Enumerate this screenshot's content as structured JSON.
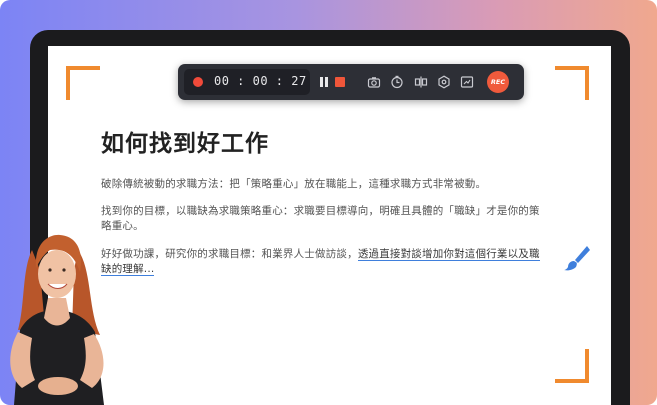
{
  "recorder": {
    "timer": "00 : 00 : 27",
    "rec_label": "REC",
    "tools": [
      "camera-icon",
      "clock-icon",
      "split-icon",
      "settings-icon",
      "screen-icon"
    ],
    "colors": {
      "accent": "#f05a3c",
      "toolbar": "#2d2f36",
      "frame": "#f08a2e",
      "highlight": "#3f7fdc"
    }
  },
  "document": {
    "title": "如何找到好工作",
    "p1": "破除傳統被動的求職方法：把「策略重心」放在職能上，這種求職方式非常被動。",
    "p2": "找到你的目標，以職缺為求職策略重心：求職要目標導向，明確且具體的「職缺」才是你的策略重心。",
    "p3_plain": "好好做功課，研究你的求職目標：和業界人士做訪談，",
    "p3_highlight": "透過直接對談增加你對這個行業以及職缺的理解..."
  }
}
